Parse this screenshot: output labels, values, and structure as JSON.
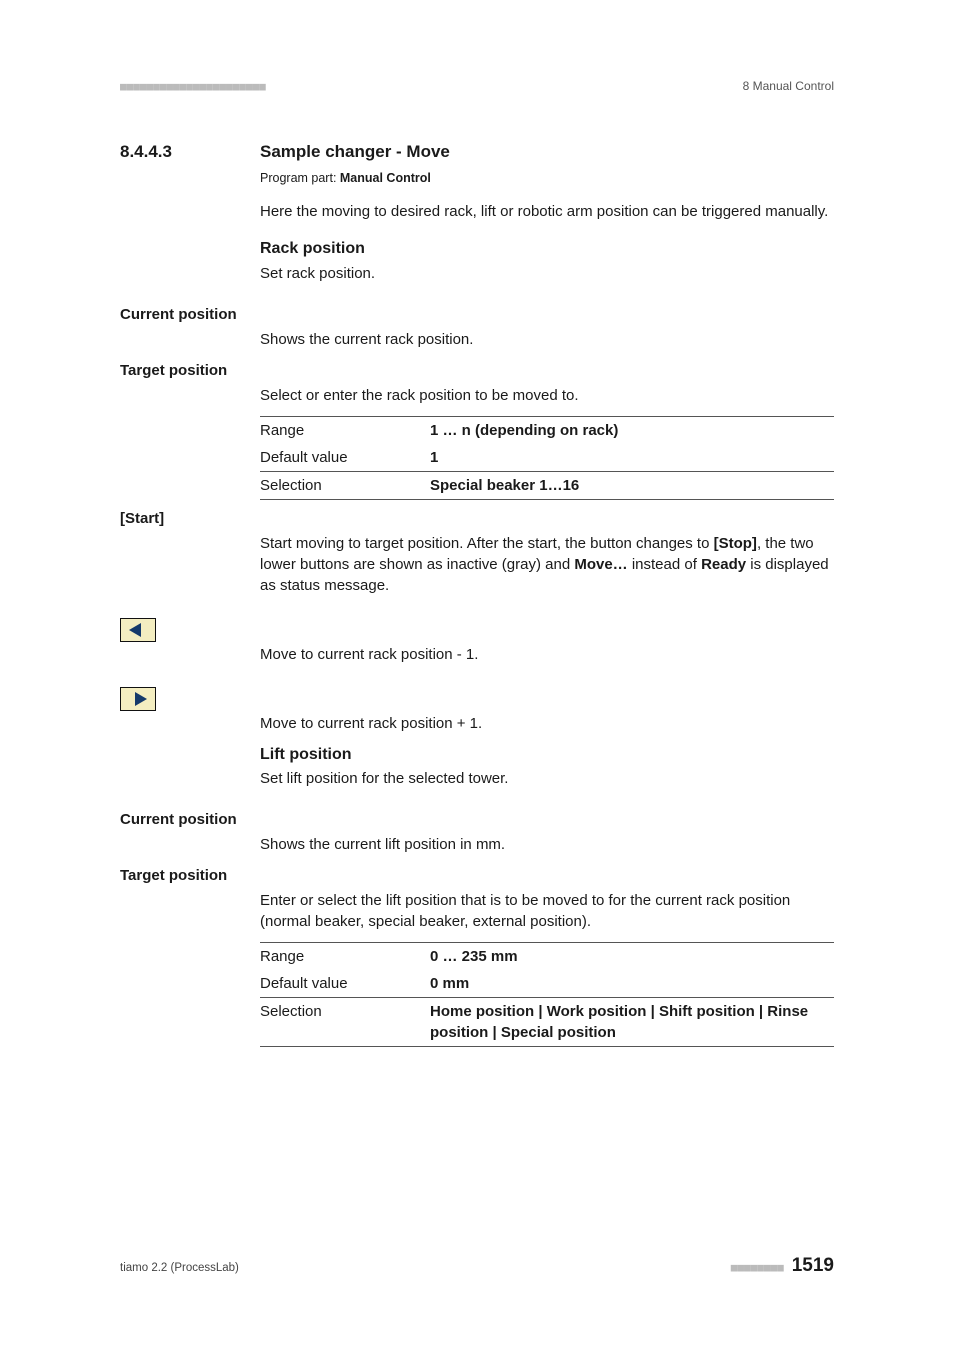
{
  "header": {
    "dashes": "■■■■■■■■■■■■■■■■■■■■■■",
    "right": "8 Manual Control"
  },
  "section": {
    "num": "8.4.4.3",
    "title": "Sample changer - Move",
    "program_part_prefix": "Program part: ",
    "program_part_bold": "Manual Control",
    "intro": "Here the moving to desired rack, lift or robotic arm position can be triggered manually."
  },
  "rack": {
    "heading": "Rack position",
    "desc": "Set rack position."
  },
  "current1": {
    "label": "Current position",
    "desc": "Shows the current rack position."
  },
  "target1": {
    "label": "Target position",
    "desc": "Select or enter the rack position to be moved to.",
    "range_label": "Range",
    "range_val": "1 … n (depending on rack)",
    "default_label": "Default value",
    "default_val": "1",
    "selection_label": "Selection",
    "selection_val": "Special beaker 1…16"
  },
  "start": {
    "label": "[Start]",
    "desc_pre": "Start moving to target position. After the start, the button changes to ",
    "desc_stop": "[Stop]",
    "desc_mid": ", the two lower buttons are shown as inactive (gray) and ",
    "desc_move": "Move…",
    "desc_mid2": " instead of ",
    "desc_ready": "Ready",
    "desc_post": " is displayed as status message."
  },
  "nav_prev": {
    "desc": "Move to current rack position - 1."
  },
  "nav_next": {
    "desc": "Move to current rack position + 1."
  },
  "lift": {
    "heading": "Lift position",
    "desc": "Set lift position for the selected tower."
  },
  "current2": {
    "label": "Current position",
    "desc": "Shows the current lift position in mm."
  },
  "target2": {
    "label": "Target position",
    "desc": "Enter or select the lift position that is to be moved to for the current rack position (normal beaker, special beaker, external position).",
    "range_label": "Range",
    "range_val": "0 … 235 mm",
    "default_label": "Default value",
    "default_val": "0 mm",
    "selection_label": "Selection",
    "selection_val": "Home position | Work position | Shift position | Rinse position | Special position"
  },
  "footer": {
    "left": "tiamo 2.2 (ProcessLab)",
    "dashes": "■■■■■■■■",
    "page": "1519"
  }
}
